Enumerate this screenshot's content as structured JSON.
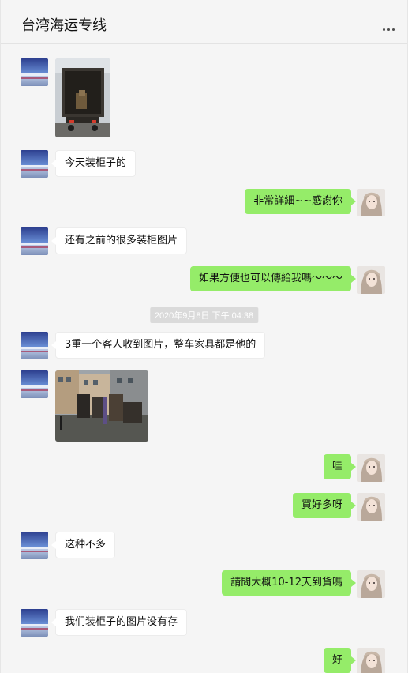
{
  "window": {
    "title": "台湾海运专线",
    "controls": {
      "pin": "⊥",
      "minimize": "—",
      "maximize": "□",
      "close": "✕"
    }
  },
  "colors": {
    "outgoing_bubble": "#95ec69",
    "incoming_bubble": "#ffffff",
    "background": "#f5f5f5"
  },
  "messages": [
    {
      "id": 1,
      "side": "in",
      "type": "image",
      "desc": "truck container photo"
    },
    {
      "id": 2,
      "side": "in",
      "type": "text",
      "text": "今天装柜子的"
    },
    {
      "id": 3,
      "side": "out",
      "type": "text",
      "text": "非常詳細~~感謝你"
    },
    {
      "id": 4,
      "side": "in",
      "type": "text",
      "text": "还有之前的很多装柜图片"
    },
    {
      "id": 5,
      "side": "out",
      "type": "text",
      "text": "如果方便也可以傳給我嗎～～～"
    },
    {
      "id": 6,
      "type": "timestamp",
      "text": "2020年9月8日 下午 04:38"
    },
    {
      "id": 7,
      "side": "in",
      "type": "text",
      "text": "3重一个客人收到图片，整车家具都是他的"
    },
    {
      "id": 8,
      "side": "in",
      "type": "image",
      "desc": "street furniture photo"
    },
    {
      "id": 9,
      "side": "out",
      "type": "text",
      "text": "哇"
    },
    {
      "id": 10,
      "side": "out",
      "type": "text",
      "text": "買好多呀"
    },
    {
      "id": 11,
      "side": "in",
      "type": "text",
      "text": "这种不多"
    },
    {
      "id": 12,
      "side": "out",
      "type": "text",
      "text": "請問大概10-12天到貨嗎"
    },
    {
      "id": 13,
      "side": "in",
      "type": "text",
      "text": "我们装柜子的图片没有存"
    },
    {
      "id": 14,
      "side": "out",
      "type": "text",
      "text": "好"
    }
  ]
}
